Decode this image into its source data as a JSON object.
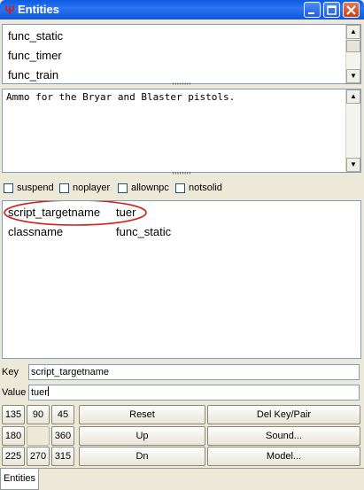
{
  "window": {
    "title": "Entities",
    "app_icon_glyph": "Ψ",
    "controls": {
      "minimize_icon": "minimize-icon",
      "maximize_icon": "maximize-icon",
      "close_icon": "close-icon"
    }
  },
  "entity_list": [
    "func_static",
    "func_timer",
    "func_train"
  ],
  "description": "Ammo for the Bryar and Blaster pistols.",
  "splitter_glyph": "''''''''",
  "spawnflags": [
    {
      "label": "suspend",
      "checked": false
    },
    {
      "label": "noplayer",
      "checked": false
    },
    {
      "label": "allownpc",
      "checked": false
    },
    {
      "label": "notsolid",
      "checked": false
    }
  ],
  "properties": [
    {
      "key": "script_targetname",
      "value": "tuer"
    },
    {
      "key": "classname",
      "value": "func_static"
    }
  ],
  "key_field": {
    "label": "Key",
    "value": "script_targetname"
  },
  "value_field": {
    "label": "Value",
    "value": "tuer"
  },
  "angle_buttons": [
    "135",
    "90",
    "45",
    "180",
    "360",
    "225",
    "270",
    "315"
  ],
  "action_buttons": {
    "reset": "Reset",
    "up": "Up",
    "dn": "Dn",
    "del_key_pair": "Del Key/Pair",
    "sound": "Sound...",
    "model": "Model..."
  },
  "tabs": [
    "Entities"
  ],
  "colors": {
    "titlebar": "#0a5ae0",
    "annotation_circle": "#d21f1f",
    "dialog_bg": "#ece9d8"
  }
}
